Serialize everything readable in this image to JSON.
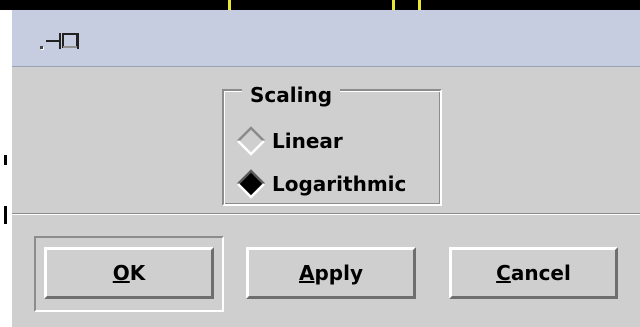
{
  "window": {
    "title_icon": "pin-icon"
  },
  "scaling": {
    "legend": "Scaling",
    "options": [
      {
        "label": "Linear",
        "selected": false
      },
      {
        "label": "Logarithmic",
        "selected": true
      }
    ]
  },
  "buttons": {
    "ok": {
      "mnemonic": "O",
      "rest": "K"
    },
    "apply": {
      "mnemonic": "A",
      "rest": "pply"
    },
    "cancel": {
      "mnemonic": "C",
      "rest": "ancel"
    }
  },
  "colors": {
    "dialog_bg": "#cfcfcf",
    "titlebar_bg": "#c6cde0",
    "selected_radio": "#000000"
  }
}
